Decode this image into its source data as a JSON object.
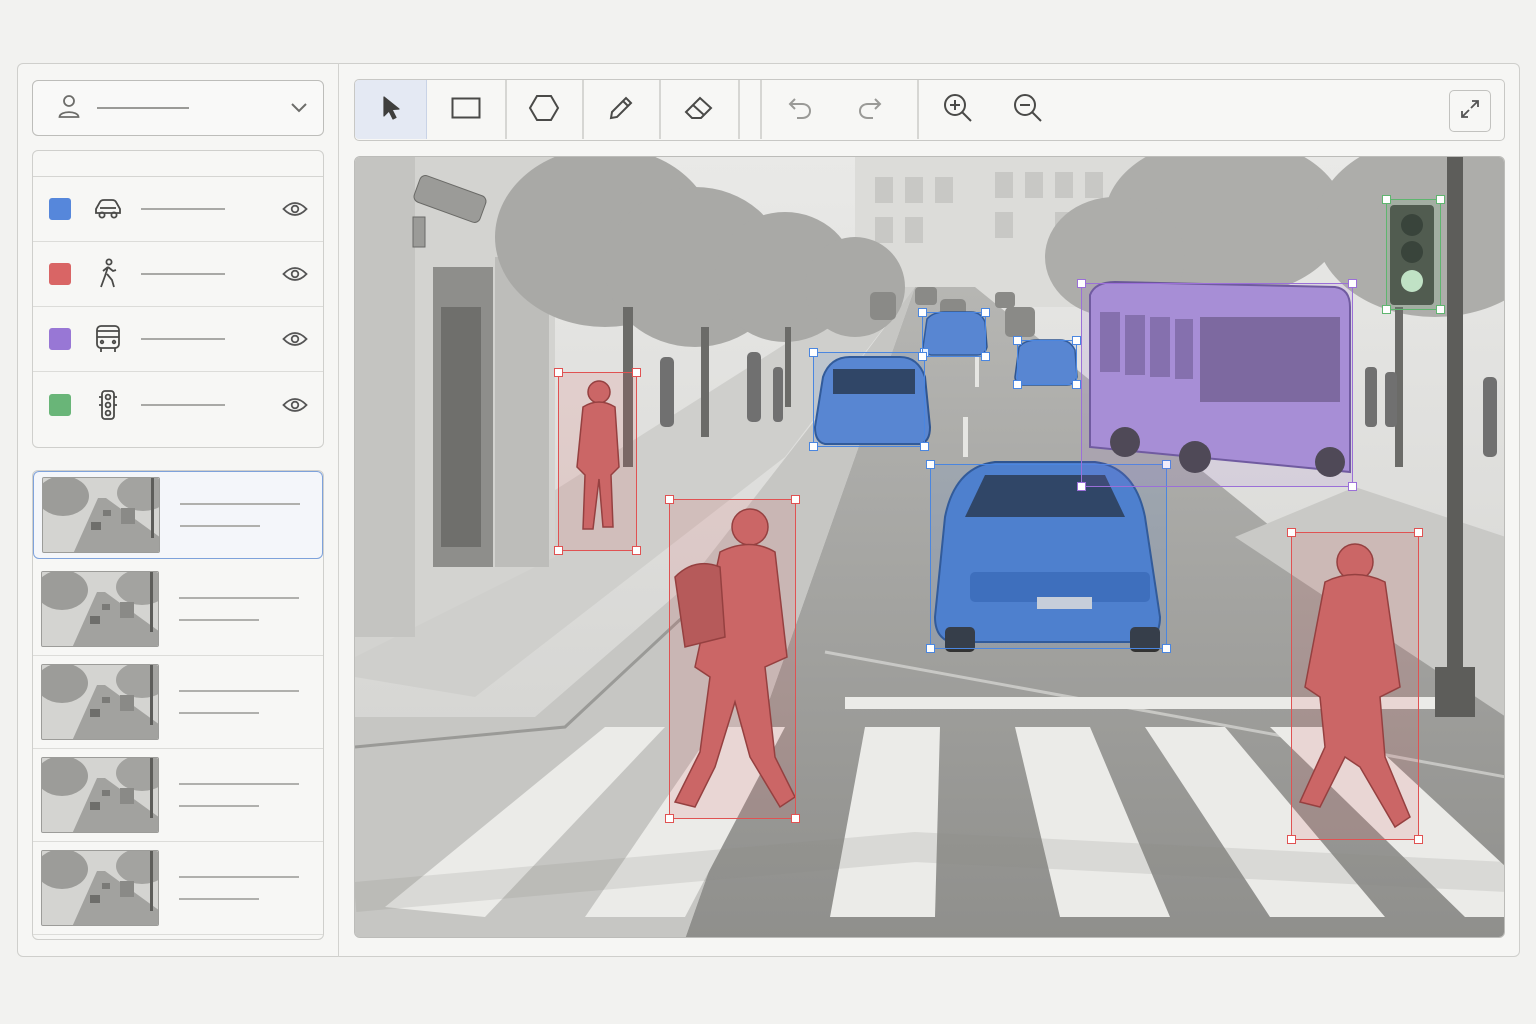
{
  "user_menu": {
    "name": "",
    "icon": "user-icon",
    "chevron": "chevron-down-icon"
  },
  "layers": [
    {
      "id": "car",
      "color": "#5b8ee6",
      "icon": "car-icon",
      "label": "",
      "visibility_icon": "eye-icon"
    },
    {
      "id": "pedestrian",
      "color": "#e46a6a",
      "icon": "pedestrian-icon",
      "label": "",
      "visibility_icon": "eye-icon"
    },
    {
      "id": "bus",
      "color": "#a07de0",
      "icon": "bus-icon",
      "label": "",
      "visibility_icon": "eye-icon"
    },
    {
      "id": "traffic-light",
      "color": "#6fbf7e",
      "icon": "traffic-light-icon",
      "label": "",
      "visibility_icon": "eye-icon"
    }
  ],
  "frames": [
    {
      "title": "",
      "subtitle": "",
      "selected": true
    },
    {
      "title": "",
      "subtitle": "",
      "selected": false
    },
    {
      "title": "",
      "subtitle": "",
      "selected": false
    },
    {
      "title": "",
      "subtitle": "",
      "selected": false
    },
    {
      "title": "",
      "subtitle": "",
      "selected": false
    }
  ],
  "toolbar": {
    "tools": [
      "select-tool",
      "rectangle-tool",
      "polygon-tool",
      "pencil-tool",
      "eraser-tool",
      "undo",
      "redo",
      "zoom-in",
      "zoom-out"
    ],
    "active_tool": "select-tool",
    "expand_icon": "expand-icon"
  },
  "annotations": [
    {
      "label": "pedestrian",
      "color": "#e05252"
    },
    {
      "label": "pedestrian",
      "color": "#e05252"
    },
    {
      "label": "pedestrian",
      "color": "#e05252"
    },
    {
      "label": "car",
      "color": "#4a86e0"
    },
    {
      "label": "car",
      "color": "#4a86e0"
    },
    {
      "label": "car",
      "color": "#4a86e0"
    },
    {
      "label": "car",
      "color": "#4a86e0"
    },
    {
      "label": "bus",
      "color": "#9b6fd8"
    },
    {
      "label": "traffic-light",
      "color": "#5fb56f"
    }
  ]
}
